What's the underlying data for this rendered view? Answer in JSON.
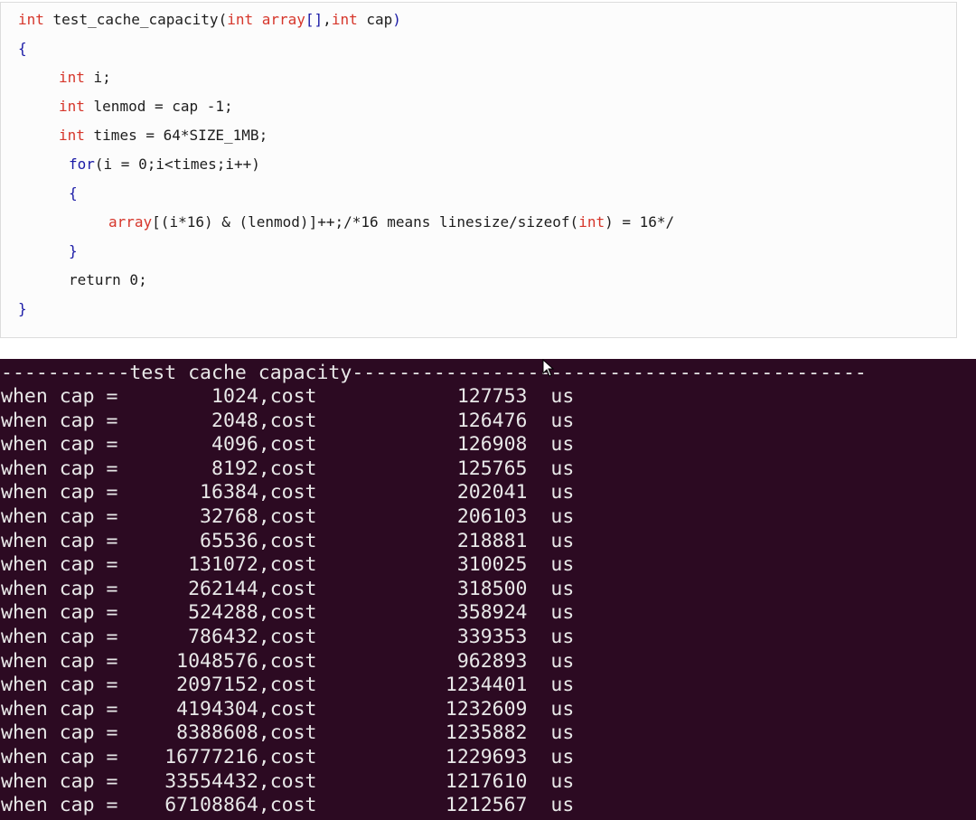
{
  "code": {
    "line1": {
      "type": "int",
      "name": " test_cache_capacity(",
      "t2": "int",
      "p1": " array",
      "br": "[]",
      "comma": ",",
      "t3": "int",
      "p2": " cap",
      "close": ")"
    },
    "line2": "{",
    "line3": {
      "type": "int",
      "rest": " i;"
    },
    "line4": {
      "type": "int",
      "rest": " lenmod = cap -1;"
    },
    "line5": {
      "type": "int",
      "rest": " times = 64*SIZE_1MB;"
    },
    "line6": {
      "kw": "for",
      "rest": "(i = 0;i<times;i++)"
    },
    "line7": "{",
    "line8": {
      "arr": "array",
      "rest": "[(i*16) & (lenmod)]++;/*16 means linesize/sizeof(",
      "t": "int",
      "end": ") = 16*/"
    },
    "line9": "}",
    "line10": "return 0;",
    "line11": "}"
  },
  "terminal": {
    "header": "-----------test cache capacity--------------------------------------------",
    "rows": [
      "when cap =        1024,cost            127753  us",
      "when cap =        2048,cost            126476  us",
      "when cap =        4096,cost            126908  us",
      "when cap =        8192,cost            125765  us",
      "when cap =       16384,cost            202041  us",
      "when cap =       32768,cost            206103  us",
      "when cap =       65536,cost            218881  us",
      "when cap =      131072,cost            310025  us",
      "when cap =      262144,cost            318500  us",
      "when cap =      524288,cost            358924  us",
      "when cap =      786432,cost            339353  us",
      "when cap =     1048576,cost            962893  us",
      "when cap =     2097152,cost           1234401  us",
      "when cap =     4194304,cost           1232609  us",
      "when cap =     8388608,cost           1235882  us",
      "when cap =    16777216,cost           1229693  us",
      "when cap =    33554432,cost           1217610  us",
      "when cap =    67108864,cost           1212567  us"
    ]
  },
  "colors": {
    "keyword": "#d6362b",
    "brace": "#1a1aa6",
    "terminal_bg": "#2c0a22",
    "terminal_text": "#e8e8e8"
  },
  "icons": {
    "cursor": "mouse-pointer-icon"
  }
}
